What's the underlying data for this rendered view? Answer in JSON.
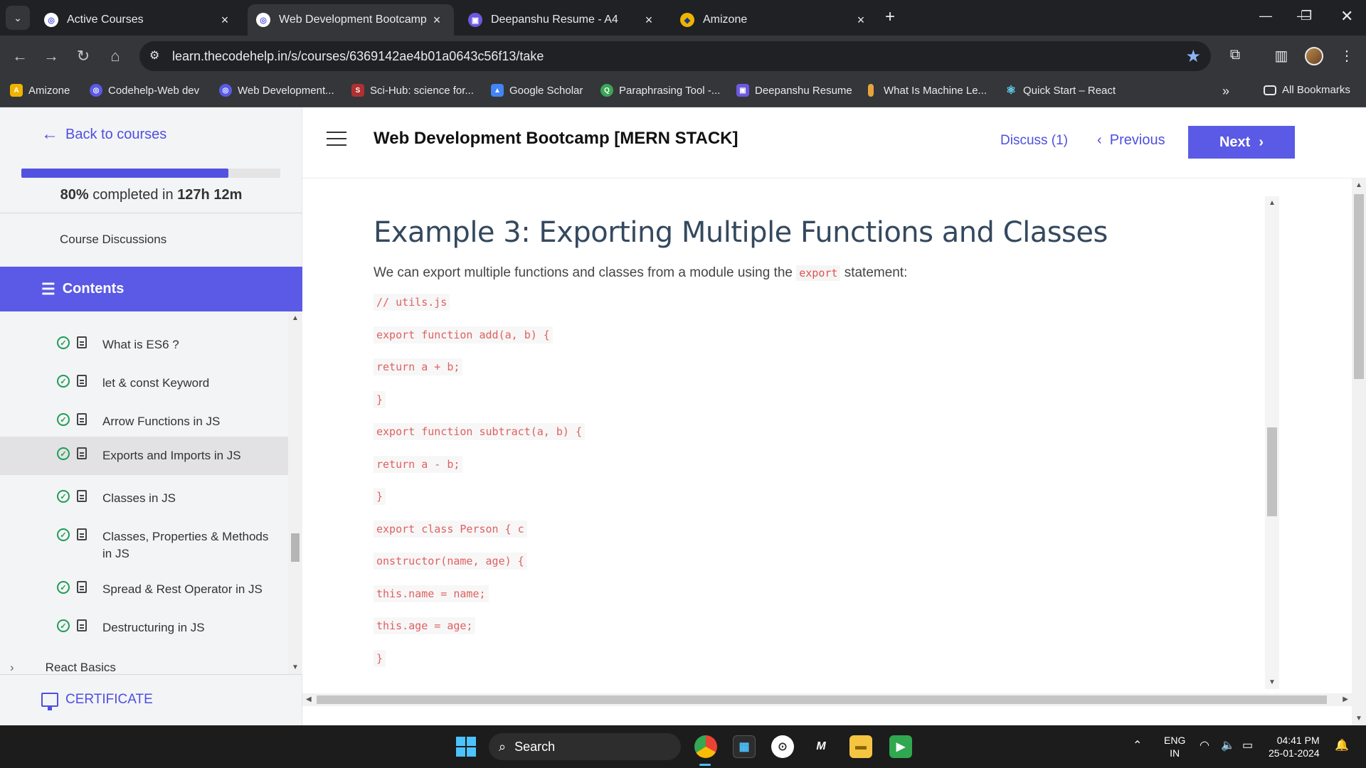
{
  "browser": {
    "tabs": [
      {
        "title": "Active Courses",
        "active": false
      },
      {
        "title": "Web Development Bootcamp [MERN STACK]",
        "active": true
      },
      {
        "title": "Deepanshu Resume - A4",
        "active": false
      },
      {
        "title": "Amizone",
        "active": false
      }
    ],
    "url": "learn.thecodehelp.in/s/courses/6369142ae4b01a0643c56f13/take",
    "bookmarks": [
      {
        "label": "Amizone",
        "icon": "amizone-icon",
        "color": "#f0b400"
      },
      {
        "label": "Codehelp-Web dev",
        "icon": "codehelp-icon",
        "color": "#5a5ae6"
      },
      {
        "label": "Web Development...",
        "icon": "codehelp-icon",
        "color": "#5a5ae6"
      },
      {
        "label": "Sci-Hub: science for...",
        "icon": "scihub-icon",
        "color": "#b03030"
      },
      {
        "label": "Google Scholar",
        "icon": "scholar-icon",
        "color": "#4285f4"
      },
      {
        "label": "Paraphrasing Tool -...",
        "icon": "quillbot-icon",
        "color": "#3aa757"
      },
      {
        "label": "Deepanshu Resume",
        "icon": "resume-icon",
        "color": "#6a5ae0"
      },
      {
        "label": "What Is Machine Le...",
        "icon": "ml-icon",
        "color": "#e8a33d"
      },
      {
        "label": "Quick Start – React",
        "icon": "react-icon",
        "color": "#61dafb"
      }
    ],
    "all_bookmarks_label": "All Bookmarks"
  },
  "sidebar": {
    "back_label": "Back to courses",
    "progress_percent": 80,
    "progress_pct_text": "80%",
    "progress_mid_text": " completed in ",
    "progress_time": "127h 12m",
    "discussions_label": "Course Discussions",
    "contents_label": "Contents",
    "lessons": [
      {
        "label": "What is ES6 ?",
        "completed": true,
        "active": false
      },
      {
        "label": "let & const Keyword",
        "completed": true,
        "active": false
      },
      {
        "label": "Arrow Functions in JS",
        "completed": true,
        "active": false
      },
      {
        "label": "Exports and Imports in JS",
        "completed": true,
        "active": true
      },
      {
        "label": "Classes in JS",
        "completed": true,
        "active": false
      },
      {
        "label": "Classes, Properties & Methods in JS",
        "completed": true,
        "active": false
      },
      {
        "label": "Spread & Rest Operator in JS",
        "completed": true,
        "active": false
      },
      {
        "label": "Destructuring in JS",
        "completed": true,
        "active": false
      }
    ],
    "next_section": "React Basics",
    "certificate_label": "CERTIFICATE"
  },
  "header": {
    "course_title": "Web Development Bootcamp [MERN STACK]",
    "discuss_label": "Discuss (1)",
    "previous_label": "Previous",
    "next_label": "Next"
  },
  "content": {
    "heading": "Example 3: Exporting Multiple Functions and Classes",
    "intro_before": "We can export multiple functions and classes from a module using the ",
    "intro_code": "export",
    "intro_after": " statement:",
    "code_lines": [
      "// utils.js",
      "export function add(a, b) {",
      "return a + b;",
      "}",
      "export function subtract(a, b) {",
      "return a - b;",
      "}",
      "export class Person { c",
      "onstructor(name, age) {",
      "this.name = name;",
      "this.age = age;",
      "}"
    ]
  },
  "taskbar": {
    "search_label": "Search",
    "lang_line1": "ENG",
    "lang_line2": "IN",
    "time": "04:41 PM",
    "date": "25-01-2024"
  }
}
